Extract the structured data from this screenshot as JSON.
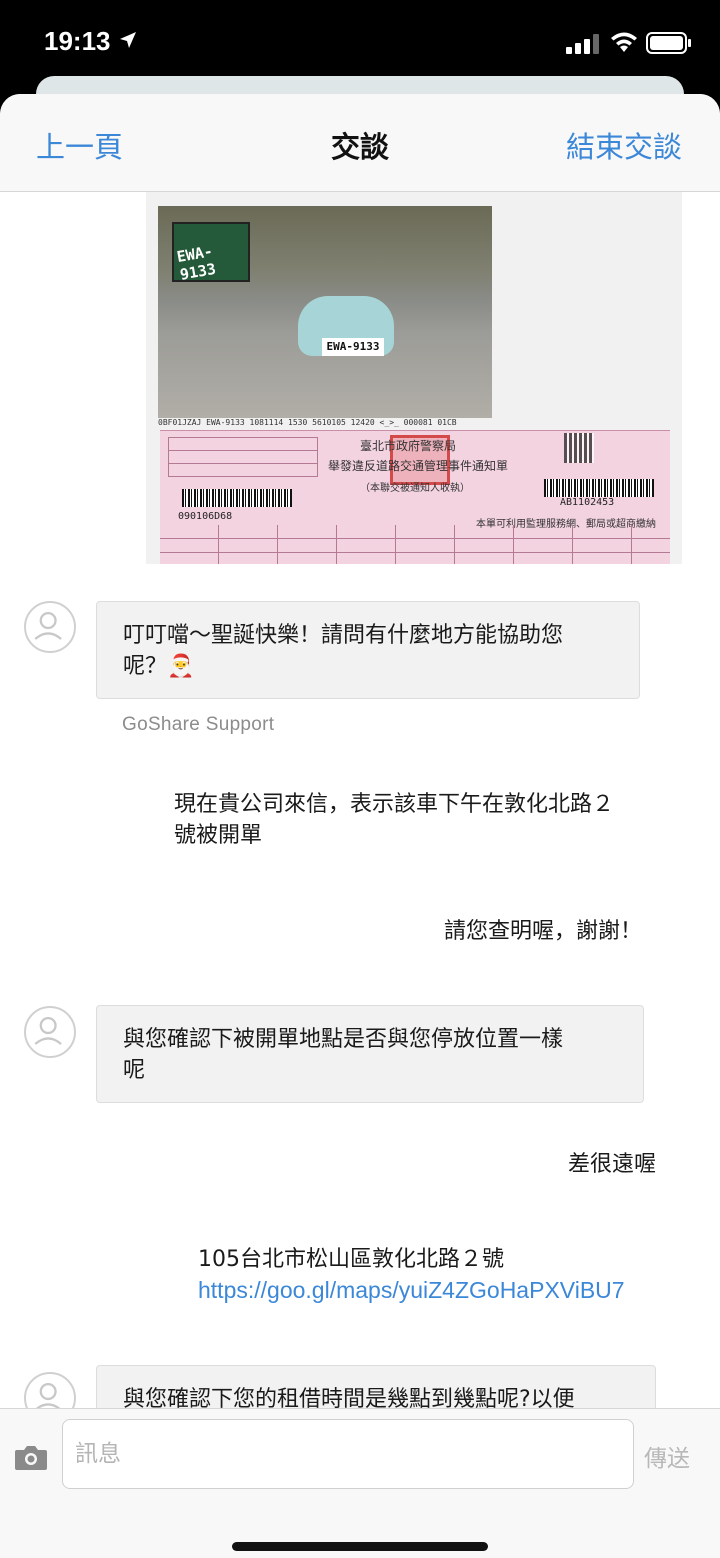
{
  "status_bar": {
    "time": "19:13"
  },
  "nav": {
    "back_label": "上一頁",
    "title": "交談",
    "end_label": "結束交談"
  },
  "attachment": {
    "plate_text": "EWA-9133",
    "scooter_plate": "EWA-9133",
    "photo_caption": "0BF01JZAJ EWA-9133 1081114 1530 5610105 12420 <_>_ 000081 01CB",
    "notice_title_line1": "臺北市政府警察局",
    "notice_title_line2": "舉發違反道路交通管理事件通知單",
    "notice_title_line3": "（本聯交被通知人收執）",
    "notice_serial": "090106D68",
    "notice_number": "AB1102453",
    "notice_footer": "本單可利用監理服務網、郵局或超商繳納"
  },
  "messages": [
    {
      "type": "incoming",
      "text_line1": "叮叮噹～聖誕快樂！請問有什麼地方能協助您",
      "text_line2": "呢？🎅",
      "sender": "GoShare Support"
    },
    {
      "type": "outgoing",
      "text_line1": "現在貴公司來信，表示該車下午在敦化北路２",
      "text_line2": "號被開單"
    },
    {
      "type": "outgoing",
      "text": "請您查明喔，謝謝！"
    },
    {
      "type": "incoming",
      "text_line1": "與您確認下被開單地點是否與您停放位置一樣",
      "text_line2": "呢"
    },
    {
      "type": "outgoing",
      "text": "差很遠喔"
    },
    {
      "type": "outgoing",
      "text": "105台北市松山區敦化北路２號",
      "link": "https://goo.gl/maps/yuiZ4ZGoHaPXViBU7"
    },
    {
      "type": "incoming",
      "text_line1": "與您確認下您的租借時間是幾點到幾點呢?以便"
    }
  ],
  "composer": {
    "placeholder": "訊息",
    "send_label": "傳送"
  }
}
